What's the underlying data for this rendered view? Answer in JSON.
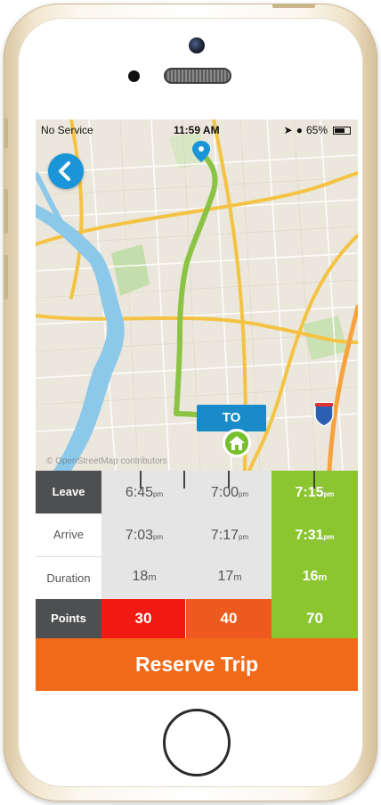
{
  "status_bar": {
    "carrier": "No Service",
    "time": "11:59 AM",
    "battery": "65%"
  },
  "map": {
    "destination_label": "TO",
    "attribution": "© OpenStreetMap contributors",
    "route_color": "#86c13b",
    "water_color": "#8cc8ea",
    "highway_color": "#f4c343"
  },
  "schedule": {
    "row_labels": {
      "leave": "Leave",
      "arrive": "Arrive",
      "duration": "Duration",
      "points": "Points"
    },
    "options": [
      {
        "leave": "6:45",
        "leave_suffix": "pm",
        "arrive": "7:03",
        "arrive_suffix": "pm",
        "duration": "18",
        "duration_unit": "m",
        "points": "30",
        "points_color": "#f11a12"
      },
      {
        "leave": "7:00",
        "leave_suffix": "pm",
        "arrive": "7:17",
        "arrive_suffix": "pm",
        "duration": "17",
        "duration_unit": "m",
        "points": "40",
        "points_color": "#ee5a1e"
      },
      {
        "leave": "7:15",
        "leave_suffix": "pm",
        "arrive": "7:31",
        "arrive_suffix": "pm",
        "duration": "16",
        "duration_unit": "m",
        "points": "70",
        "points_color": "#8bc530"
      }
    ],
    "selected_index": 2
  },
  "actions": {
    "reserve_label": "Reserve Trip"
  },
  "colors": {
    "accent_blue": "#1a96d8",
    "reserve_orange": "#f06a1a",
    "selected_green": "#8bc530"
  }
}
